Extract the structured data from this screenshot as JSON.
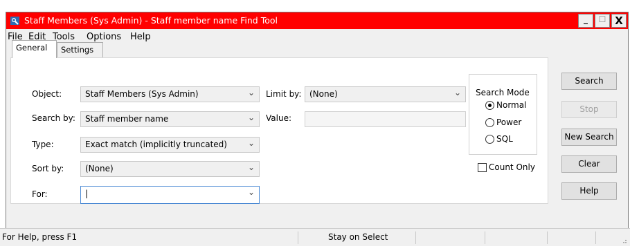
{
  "window": {
    "title": "Staff Members (Sys Admin) - Staff member name Find Tool",
    "minimize_label": "_",
    "maximize_label": "☐",
    "close_label": "X"
  },
  "menu": [
    "File",
    "Edit",
    "Tools",
    "Options",
    "Help"
  ],
  "tabs": [
    {
      "label": "General",
      "active": true
    },
    {
      "label": "Settings",
      "active": false
    }
  ],
  "form": {
    "object_label": "Object:",
    "object_value": "Staff Members (Sys Admin)",
    "search_by_label": "Search by:",
    "search_by_value": "Staff member name",
    "type_label": "Type:",
    "type_value": "Exact match (implicitly truncated)",
    "sort_by_label": "Sort by:",
    "sort_by_value": "(None)",
    "for_label": "For:",
    "for_value": "|",
    "limit_by_label": "Limit by:",
    "limit_by_value": "(None)",
    "value_label": "Value:",
    "value_value": ""
  },
  "search_mode": {
    "title": "Search Mode",
    "options": [
      {
        "label": "Normal",
        "selected": true
      },
      {
        "label": "Power",
        "selected": false
      },
      {
        "label": "SQL",
        "selected": false
      }
    ]
  },
  "count_only": {
    "label": "Count Only",
    "checked": false
  },
  "buttons": {
    "search": "Search",
    "stop": "Stop",
    "new_search": "New Search",
    "clear": "Clear",
    "help": "Help"
  },
  "status": {
    "help_text": "For Help, press F1",
    "mode_text": "Stay on Select"
  },
  "colors": {
    "titlebar": "#ff0000",
    "accent_border": "#4b8ad4"
  },
  "icons": {
    "app": "staff-finder-icon",
    "chevron": "chevron-down-icon"
  }
}
